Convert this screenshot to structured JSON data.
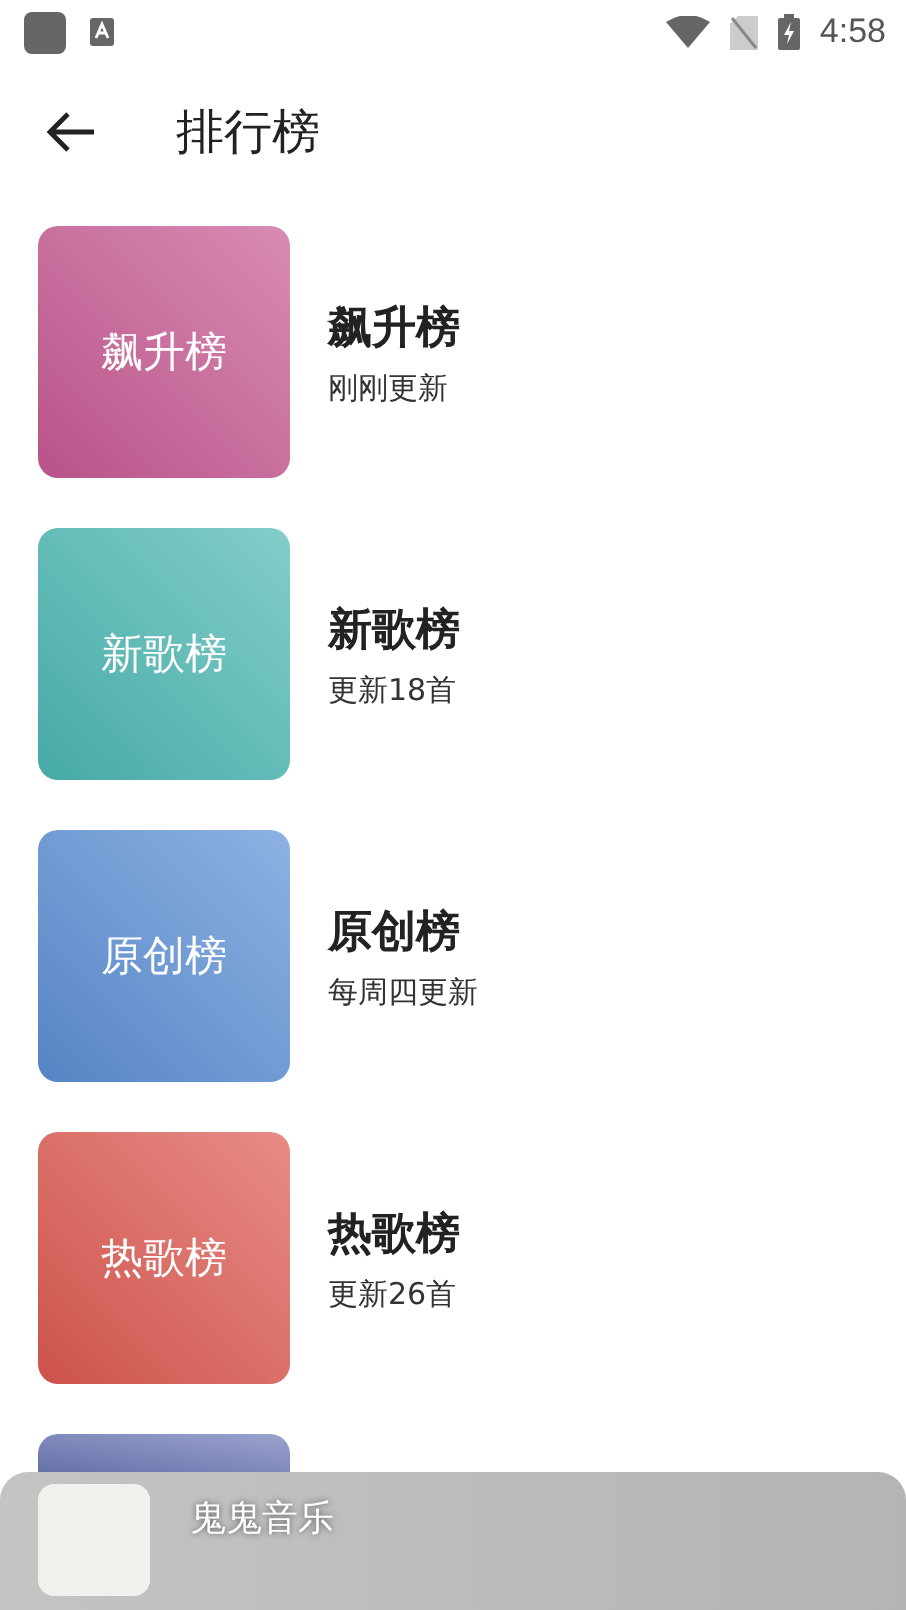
{
  "status_bar": {
    "time": "4:58"
  },
  "header": {
    "title": "排行榜"
  },
  "charts": [
    {
      "cover_label": "飙升榜",
      "title": "飙升榜",
      "subtitle": "刚刚更新",
      "color": "#c85a94"
    },
    {
      "cover_label": "新歌榜",
      "title": "新歌榜",
      "subtitle": "更新18首",
      "color": "#4cb8b4"
    },
    {
      "cover_label": "原创榜",
      "title": "原创榜",
      "subtitle": "每周四更新",
      "color": "#5c90d6"
    },
    {
      "cover_label": "热歌榜",
      "title": "热歌榜",
      "subtitle": "更新26首",
      "color": "#de5a52"
    },
    {
      "color": "#6f7bb8"
    }
  ],
  "player": {
    "title": "鬼鬼音乐"
  }
}
